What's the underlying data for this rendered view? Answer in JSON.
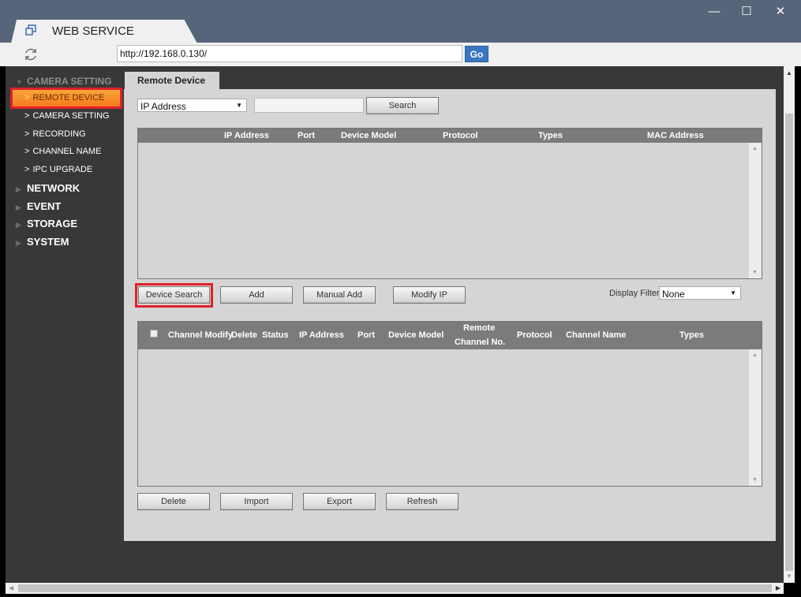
{
  "window": {
    "tab_title": "WEB SERVICE",
    "minimize_glyph": "—",
    "maximize_glyph": "☐",
    "close_glyph": "✕"
  },
  "toolbar": {
    "url": "http://192.168.0.130/",
    "go_label": "Go"
  },
  "sidebar": {
    "groups": [
      {
        "label": "CAMERA SETTING",
        "expanded": true
      },
      {
        "label": "NETWORK",
        "expanded": false
      },
      {
        "label": "EVENT",
        "expanded": false
      },
      {
        "label": "STORAGE",
        "expanded": false
      },
      {
        "label": "SYSTEM",
        "expanded": false
      }
    ],
    "items": [
      {
        "label": "REMOTE DEVICE",
        "active": true
      },
      {
        "label": "CAMERA SETTING",
        "active": false
      },
      {
        "label": "RECORDING",
        "active": false
      },
      {
        "label": "CHANNEL NAME",
        "active": false
      },
      {
        "label": "IPC UPGRADE",
        "active": false
      }
    ],
    "chevron": ">",
    "collapsed_arrow": "▶",
    "expanded_arrow": "▼"
  },
  "main": {
    "tab_label": "Remote Device",
    "search_filter": {
      "selected": "IP Address",
      "value": "",
      "search_label": "Search"
    },
    "device_table": {
      "columns": [
        "IP Address",
        "Port",
        "Device Model",
        "Protocol",
        "Types",
        "MAC Address"
      ],
      "rows": []
    },
    "device_actions": [
      "Device Search",
      "Add",
      "Manual Add",
      "Modify IP"
    ],
    "display_filter": {
      "label": "Display Filter",
      "selected": "None"
    },
    "added_table": {
      "columns": [
        "Channel Modify",
        "Delete",
        "Status",
        "IP Address",
        "Port",
        "Device Model",
        "Remote",
        "Channel No.",
        "Protocol",
        "Channel Name",
        "Types"
      ],
      "rows": []
    },
    "added_actions": [
      "Delete",
      "Import",
      "Export",
      "Refresh"
    ]
  },
  "highlight_color": "#e0202a",
  "accent_color": "#f47a1c"
}
